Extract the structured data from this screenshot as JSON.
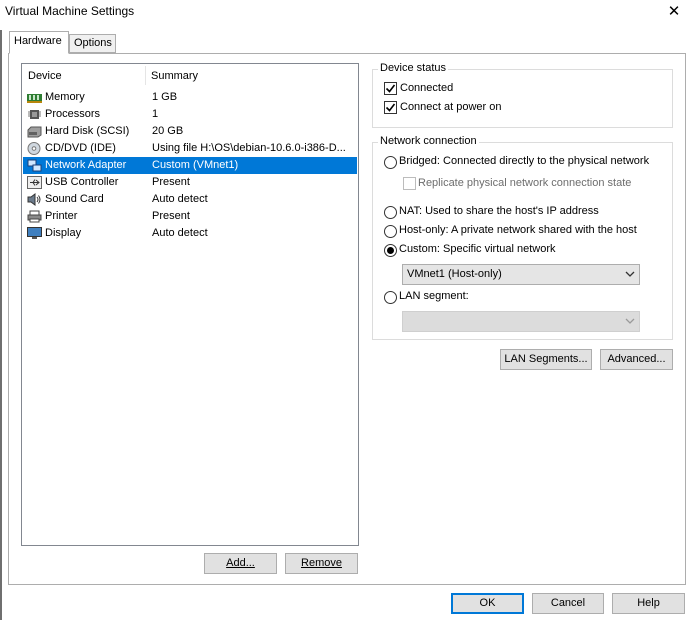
{
  "window": {
    "title": "Virtual Machine Settings",
    "close_glyph": "✕"
  },
  "tabs": [
    {
      "label": "Hardware"
    },
    {
      "label": "Options"
    }
  ],
  "device_list": {
    "columns": {
      "device": "Device",
      "summary": "Summary"
    },
    "rows": [
      {
        "device": "Memory",
        "summary": "1 GB",
        "icon": "memory-icon"
      },
      {
        "device": "Processors",
        "summary": "1",
        "icon": "processor-icon"
      },
      {
        "device": "Hard Disk (SCSI)",
        "summary": "20 GB",
        "icon": "hard-disk-icon"
      },
      {
        "device": "CD/DVD (IDE)",
        "summary": "Using file H:\\OS\\debian-10.6.0-i386-D...",
        "icon": "cd-dvd-icon"
      },
      {
        "device": "Network Adapter",
        "summary": "Custom (VMnet1)",
        "icon": "network-adapter-icon",
        "selected": true
      },
      {
        "device": "USB Controller",
        "summary": "Present",
        "icon": "usb-icon"
      },
      {
        "device": "Sound Card",
        "summary": "Auto detect",
        "icon": "sound-card-icon"
      },
      {
        "device": "Printer",
        "summary": "Present",
        "icon": "printer-icon"
      },
      {
        "device": "Display",
        "summary": "Auto detect",
        "icon": "display-icon"
      }
    ]
  },
  "list_buttons": {
    "add": "Add...",
    "remove": "Remove"
  },
  "device_status": {
    "title": "Device status",
    "connected": {
      "label": "Connected",
      "checked": true
    },
    "connect_at_power_on": {
      "label": "Connect at power on",
      "checked": true
    }
  },
  "network_connection": {
    "title": "Network connection",
    "bridged": {
      "label": "Bridged: Connected directly to the physical network",
      "selected": false
    },
    "replicate": {
      "label": "Replicate physical network connection state",
      "checked": false,
      "disabled": true
    },
    "nat": {
      "label": "NAT: Used to share the host's IP address",
      "selected": false
    },
    "host_only": {
      "label": "Host-only: A private network shared with the host",
      "selected": false
    },
    "custom": {
      "label": "Custom: Specific virtual network",
      "selected": true
    },
    "custom_network_value": "VMnet1 (Host-only)",
    "lan_segment": {
      "label": "LAN segment:",
      "selected": false
    },
    "lan_segment_value": ""
  },
  "network_buttons": {
    "lan_segments": "LAN Segments...",
    "advanced": "Advanced..."
  },
  "dialog_buttons": {
    "ok": "OK",
    "cancel": "Cancel",
    "help": "Help"
  },
  "colors": {
    "selection": "#0078d7",
    "button_face": "#e1e1e1",
    "border": "#adadad"
  }
}
